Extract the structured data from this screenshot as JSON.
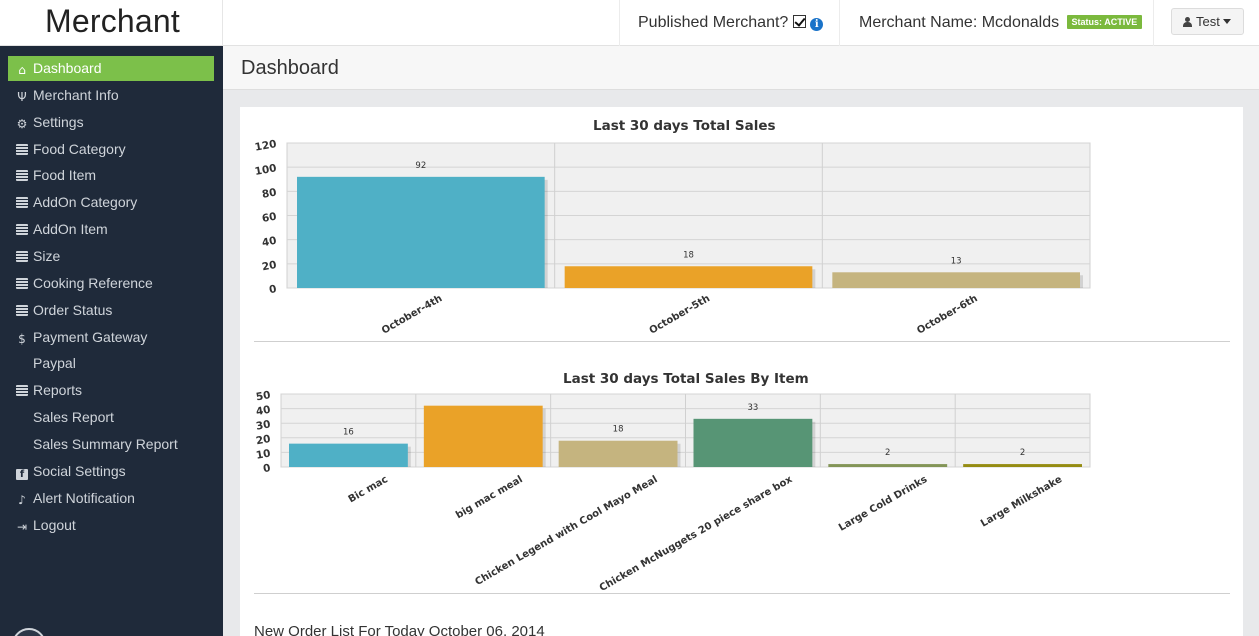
{
  "app": {
    "brand": "Merchant"
  },
  "header": {
    "published_label": "Published Merchant?",
    "merchant_name_label": "Merchant Name: Mcdonalds",
    "status_badge": "Status: ACTIVE",
    "user_label": "Test"
  },
  "sidebar": {
    "items": [
      {
        "label": "Dashboard",
        "icon": "home-icon"
      },
      {
        "label": "Merchant Info",
        "icon": "cutlery-icon"
      },
      {
        "label": "Settings",
        "icon": "gear-icon"
      },
      {
        "label": "Food Category",
        "icon": "list-icon"
      },
      {
        "label": "Food Item",
        "icon": "list-icon"
      },
      {
        "label": "AddOn Category",
        "icon": "list-icon"
      },
      {
        "label": "AddOn Item",
        "icon": "list-icon"
      },
      {
        "label": "Size",
        "icon": "list-icon"
      },
      {
        "label": "Cooking Reference",
        "icon": "list-icon"
      },
      {
        "label": "Order Status",
        "icon": "list-icon"
      },
      {
        "label": "Payment Gateway",
        "icon": "dollar-icon"
      },
      {
        "label": "Paypal",
        "icon": ""
      },
      {
        "label": "Reports",
        "icon": "list-icon"
      },
      {
        "label": "Sales Report",
        "icon": ""
      },
      {
        "label": "Sales Summary Report",
        "icon": ""
      },
      {
        "label": "Social Settings",
        "icon": "facebook-icon"
      },
      {
        "label": "Alert Notification",
        "icon": "bell-icon"
      },
      {
        "label": "Logout",
        "icon": "logout-icon"
      }
    ]
  },
  "main": {
    "page_title": "Dashboard",
    "order_list_title": "New Order List For Today October 06, 2014"
  },
  "colors": {
    "sidebar_bg": "#1f2a3a",
    "active": "#7cc04a",
    "bar_blue": "#4fb0c6",
    "bar_orange": "#eaa228",
    "bar_tan": "#c5b47f",
    "bar_green": "#579575",
    "bar_olive": "#839557",
    "bar_gold": "#958c12"
  },
  "chart_data": [
    {
      "type": "bar",
      "title": "Last 30 days Total Sales",
      "categories": [
        "October-4th",
        "October-5th",
        "October-6th"
      ],
      "values": [
        92,
        18,
        13
      ],
      "labels": [
        "92",
        "18",
        "13"
      ],
      "yticks": [
        "0",
        "20",
        "40",
        "60",
        "80",
        "100",
        "120"
      ],
      "ylim": [
        0,
        120
      ],
      "grid": true,
      "colors": [
        "#4fb0c6",
        "#eaa228",
        "#c5b47f"
      ]
    },
    {
      "type": "bar",
      "title": "Last 30 days Total Sales By Item",
      "categories": [
        "Bic mac",
        "big mac meal",
        "Chicken Legend with Cool Mayo Meal",
        "Chicken McNuggets 20 piece share box",
        "Large Cold Drinks",
        "Large Milkshake"
      ],
      "values": [
        16,
        42,
        18,
        33,
        2,
        2
      ],
      "labels": [
        "16",
        "",
        "18",
        "33",
        "2",
        "2"
      ],
      "yticks": [
        "0",
        "10",
        "20",
        "30",
        "40",
        "50"
      ],
      "ylim": [
        0,
        50
      ],
      "grid": true,
      "colors": [
        "#4fb0c6",
        "#eaa228",
        "#c5b47f",
        "#579575",
        "#839557",
        "#958c12"
      ]
    }
  ]
}
